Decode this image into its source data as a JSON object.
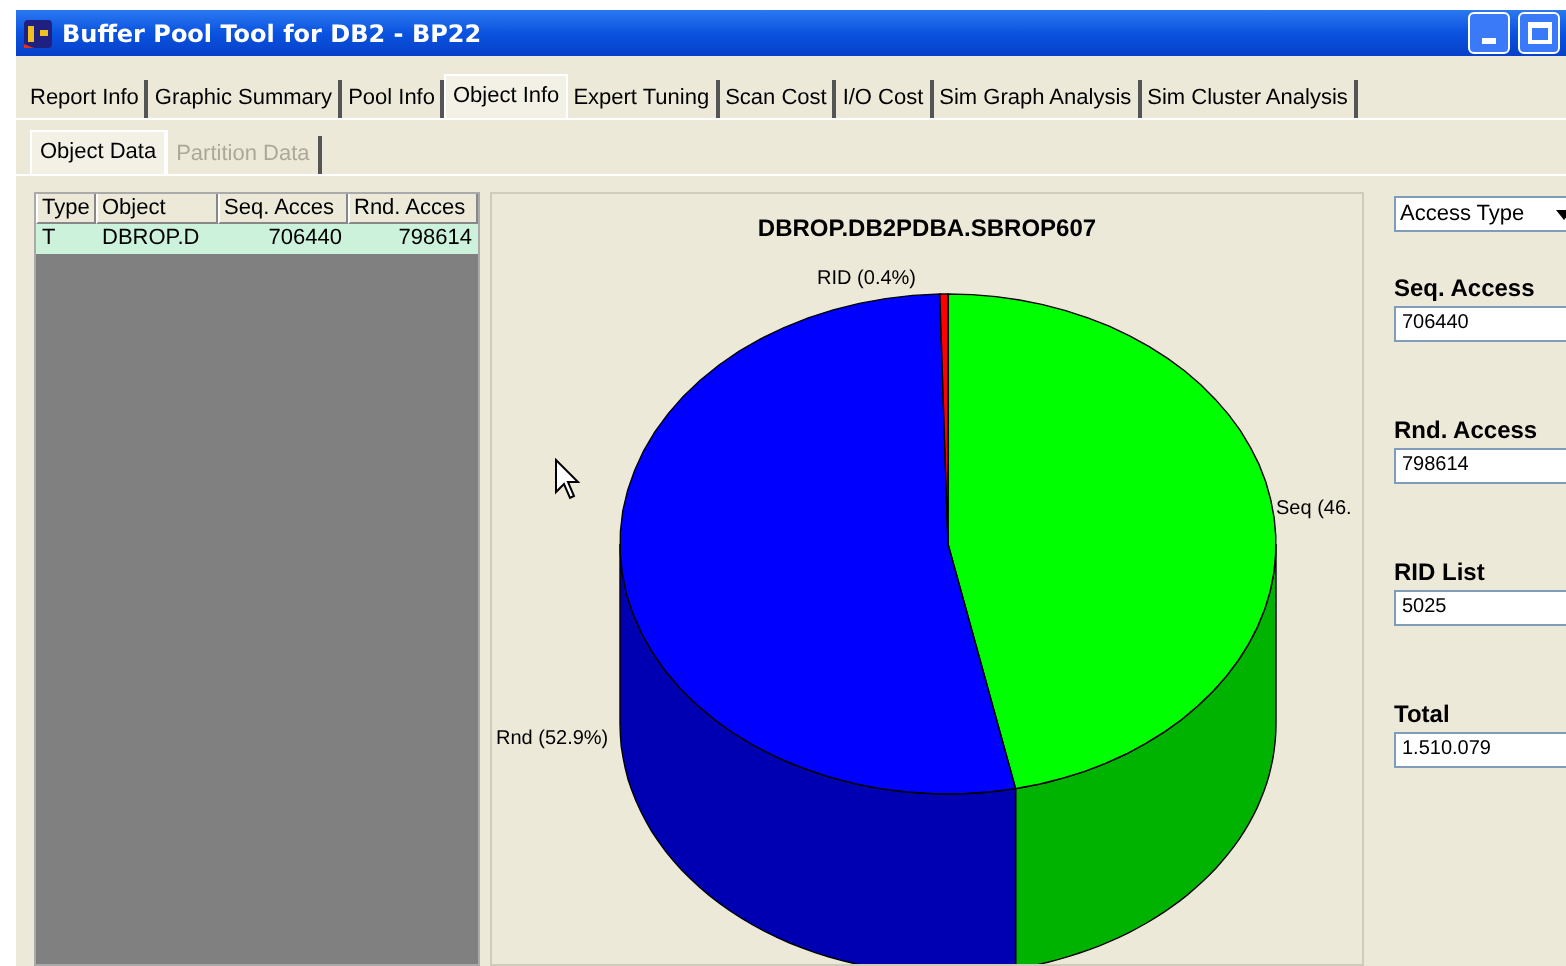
{
  "window": {
    "title": "Buffer Pool Tool for DB2 - BP22"
  },
  "tabs": [
    {
      "label": "Report Info",
      "selected": false
    },
    {
      "label": "Graphic Summary",
      "selected": false
    },
    {
      "label": "Pool Info",
      "selected": false
    },
    {
      "label": "Object Info",
      "selected": true
    },
    {
      "label": "Expert Tuning",
      "selected": false
    },
    {
      "label": "Scan Cost",
      "selected": false
    },
    {
      "label": "I/O Cost",
      "selected": false
    },
    {
      "label": "Sim Graph Analysis",
      "selected": false
    },
    {
      "label": "Sim Cluster Analysis",
      "selected": false
    }
  ],
  "subtabs": [
    {
      "label": "Object Data",
      "selected": true,
      "disabled": false
    },
    {
      "label": "Partition Data",
      "selected": false,
      "disabled": true
    }
  ],
  "table": {
    "columns": [
      "Type",
      "Object",
      "Seq. Acces",
      "Rnd. Acces"
    ],
    "rows": [
      {
        "cells": [
          "T",
          "DBROP.D",
          "706440",
          "798614"
        ],
        "selected": true
      }
    ]
  },
  "chart": {
    "title": "DBROP.DB2PDBA.SBROP607",
    "slices": [
      {
        "label": "Seq (46.",
        "color": "#00ff00"
      },
      {
        "label": "Rnd (52.9%)",
        "color": "#0000ff"
      },
      {
        "label": "RID (0.4%)",
        "color": "#ff0000"
      }
    ]
  },
  "side_panel": {
    "dropdown": "Access Type",
    "fields": [
      {
        "label": "Seq. Access",
        "value": "706440"
      },
      {
        "label": "Rnd. Access",
        "value": "798614"
      },
      {
        "label": "RID List",
        "value": "5025"
      },
      {
        "label": "Total",
        "value": "1.510.079"
      }
    ]
  }
}
